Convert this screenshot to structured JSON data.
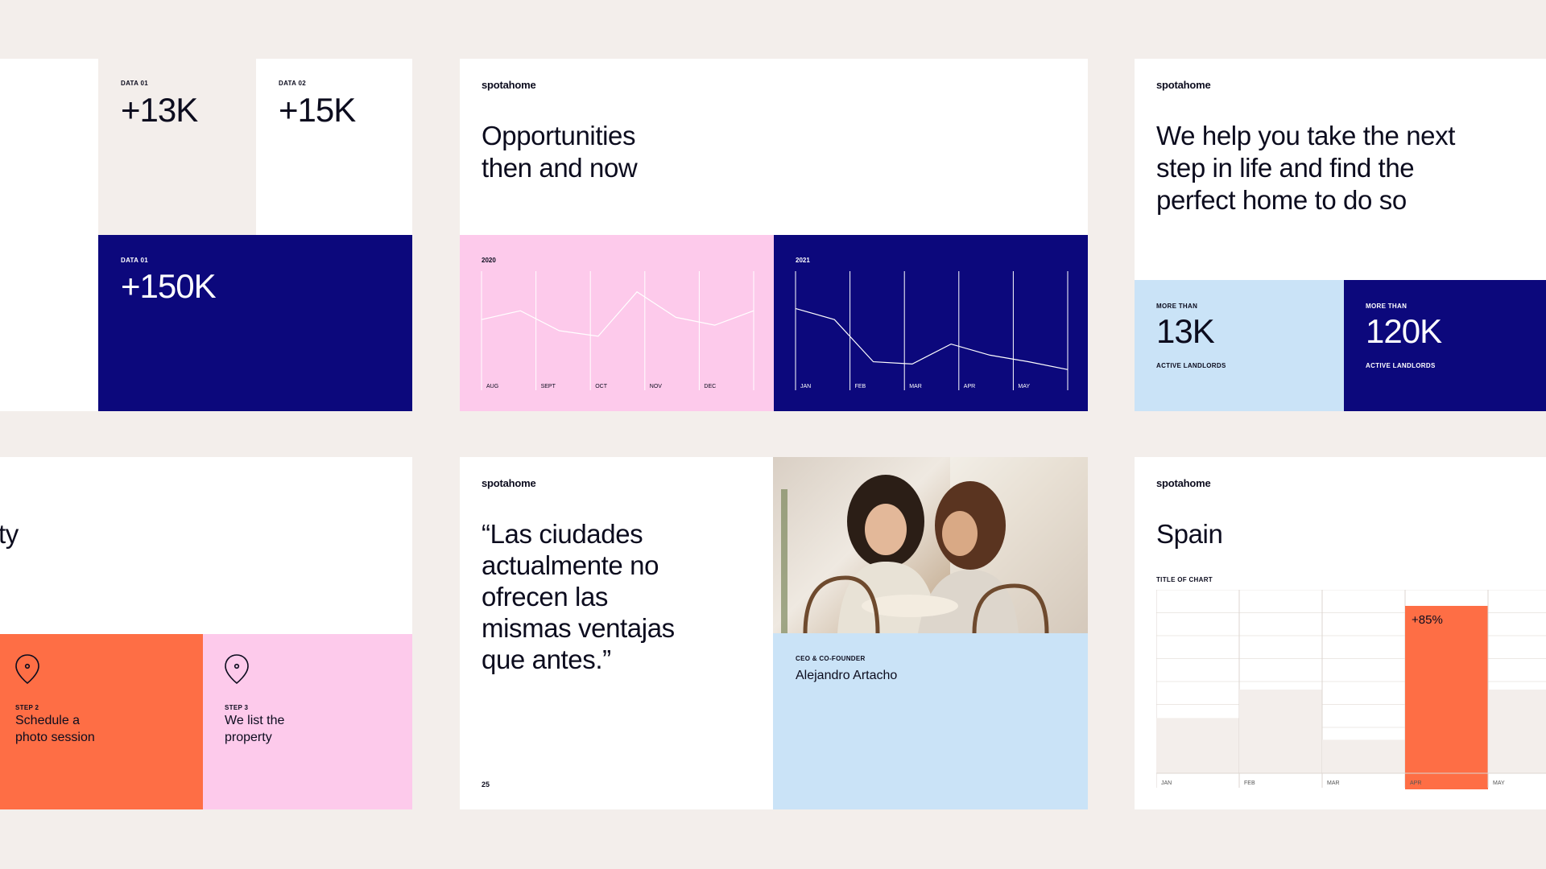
{
  "brand": {
    "logo": "spotahome"
  },
  "slide_data": {
    "tile1": {
      "label": "DATA 01",
      "value": "+13K"
    },
    "tile2": {
      "label": "DATA 02",
      "value": "+15K"
    },
    "tile3": {
      "label": "DATA 01",
      "value": "+150K"
    }
  },
  "slide_opportunities": {
    "title_line1": "Opportunities",
    "title_line2": "then and now",
    "chart_2020": {
      "year": "2020",
      "months": [
        "AUG",
        "SEPT",
        "OCT",
        "NOV",
        "DEC"
      ],
      "values": [
        0.6,
        0.68,
        0.5,
        0.45,
        0.85,
        0.62,
        0.55,
        0.68
      ]
    },
    "chart_2021": {
      "year": "2021",
      "months": [
        "JAN",
        "FEB",
        "MAR",
        "APR",
        "MAY"
      ],
      "values": [
        0.7,
        0.6,
        0.22,
        0.2,
        0.38,
        0.28,
        0.22,
        0.15
      ]
    }
  },
  "slide_help": {
    "headline_line1": "We help you take the next",
    "headline_line2": "step in life and find the",
    "headline_line3": "perfect home to do so",
    "stat1": {
      "prefix": "MORE THAN",
      "value": "13K",
      "caption": "ACTIVE LANDLORDS"
    },
    "stat2": {
      "prefix": "MORE THAN",
      "value": "120K",
      "caption": "ACTIVE LANDLORDS"
    }
  },
  "slide_steps": {
    "partial_title": "ty",
    "step2": {
      "label": "STEP 2",
      "line1": "Schedule a",
      "line2": "photo session"
    },
    "step3": {
      "label": "STEP 3",
      "line1": "We list the",
      "line2": "property"
    }
  },
  "slide_quote": {
    "quote_lines": [
      "“Las ciudades",
      "actualmente no",
      "ofrecen las",
      "mismas ventajas",
      "que antes.”"
    ],
    "page_number": "25",
    "role": "CEO & CO-FOUNDER",
    "name": "Alejandro Artacho"
  },
  "slide_spain": {
    "title": "Spain",
    "chart_data": {
      "type": "bar",
      "title": "TITLE OF CHART",
      "categories": [
        "JAN",
        "FEB",
        "MAR",
        "APR",
        "MAY"
      ],
      "values": [
        0.33,
        0.5,
        0.2,
        1.0,
        0.5
      ],
      "highlight_index": 3,
      "highlight_label": "+85%",
      "colors": {
        "base": "#f3eeeb",
        "highlight": "#fe6e45"
      }
    }
  },
  "colors": {
    "navy": "#0c087c",
    "pink": "#fdcaeb",
    "sky": "#cae3f7",
    "orange": "#fe6e45",
    "beige": "#f3eeeb"
  }
}
